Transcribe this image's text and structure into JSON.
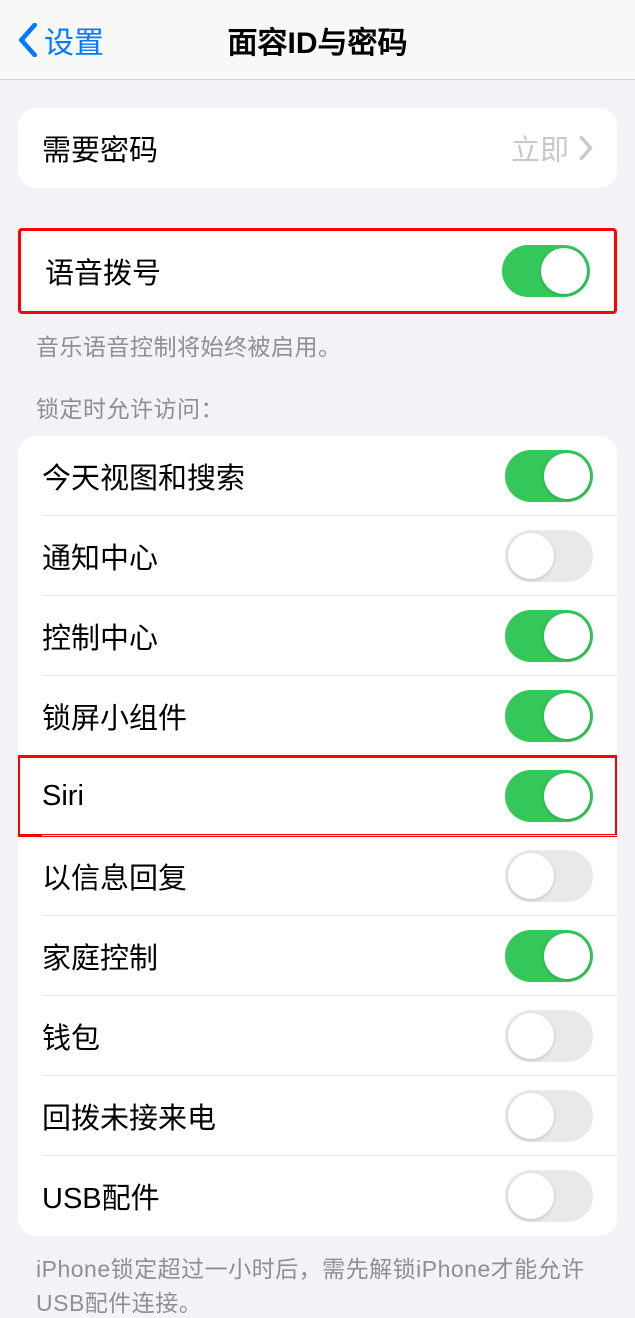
{
  "nav": {
    "back_label": "设置",
    "title": "面容ID与密码"
  },
  "passcode_group": {
    "require_passcode": {
      "label": "需要密码",
      "value": "立即"
    }
  },
  "voice_dial": {
    "label": "语音拨号",
    "on": true,
    "footer": "音乐语音控制将始终被启用。"
  },
  "lock_access": {
    "header": "锁定时允许访问：",
    "items": [
      {
        "label": "今天视图和搜索",
        "on": true
      },
      {
        "label": "通知中心",
        "on": false
      },
      {
        "label": "控制中心",
        "on": true
      },
      {
        "label": "锁屏小组件",
        "on": true
      },
      {
        "label": "Siri",
        "on": true
      },
      {
        "label": "以信息回复",
        "on": false
      },
      {
        "label": "家庭控制",
        "on": true
      },
      {
        "label": "钱包",
        "on": false
      },
      {
        "label": "回拨未接来电",
        "on": false
      },
      {
        "label": "USB配件",
        "on": false
      }
    ],
    "footer": "iPhone锁定超过一小时后，需先解锁iPhone才能允许USB配件连接。"
  },
  "highlighted_rows": [
    "语音拨号",
    "Siri"
  ]
}
